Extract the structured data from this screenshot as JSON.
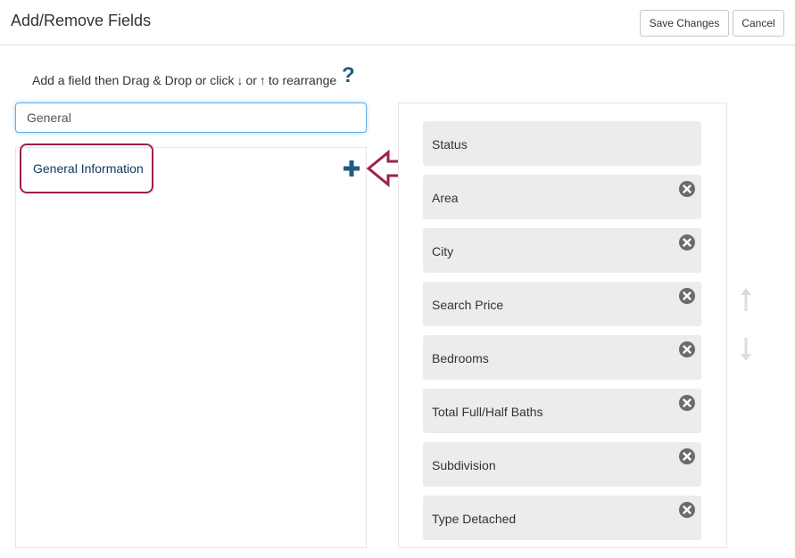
{
  "header": {
    "title": "Add/Remove Fields",
    "save_label": "Save Changes",
    "cancel_label": "Cancel"
  },
  "instructions": {
    "part1": "Add a field then Drag & Drop or click",
    "arrow_down": "↓",
    "or": "or",
    "arrow_up": "↑",
    "part2": "to rearrange",
    "help": "?"
  },
  "search": {
    "value": "General",
    "placeholder": ""
  },
  "available": {
    "items": [
      {
        "label": "General Information"
      }
    ]
  },
  "selected": {
    "fields": [
      {
        "label": "Status",
        "removable": false
      },
      {
        "label": "Area",
        "removable": true
      },
      {
        "label": "City",
        "removable": true
      },
      {
        "label": "Search Price",
        "removable": true
      },
      {
        "label": "Bedrooms",
        "removable": true
      },
      {
        "label": "Total Full/Half Baths",
        "removable": true
      },
      {
        "label": "Subdivision",
        "removable": true
      },
      {
        "label": "Type Detached",
        "removable": true
      }
    ]
  },
  "colors": {
    "accent": "#1f5c7a",
    "highlight": "#9b2148",
    "field_bg": "#ececec",
    "remove_icon": "#6b6b6b",
    "reorder_arrows": "#dcdcdc"
  },
  "icons": {
    "help": "question-mark-icon",
    "add": "plus-icon",
    "remove": "close-circle-icon",
    "move_up": "arrow-up-icon",
    "move_down": "arrow-down-icon",
    "pointer": "arrow-left-outline-icon"
  }
}
